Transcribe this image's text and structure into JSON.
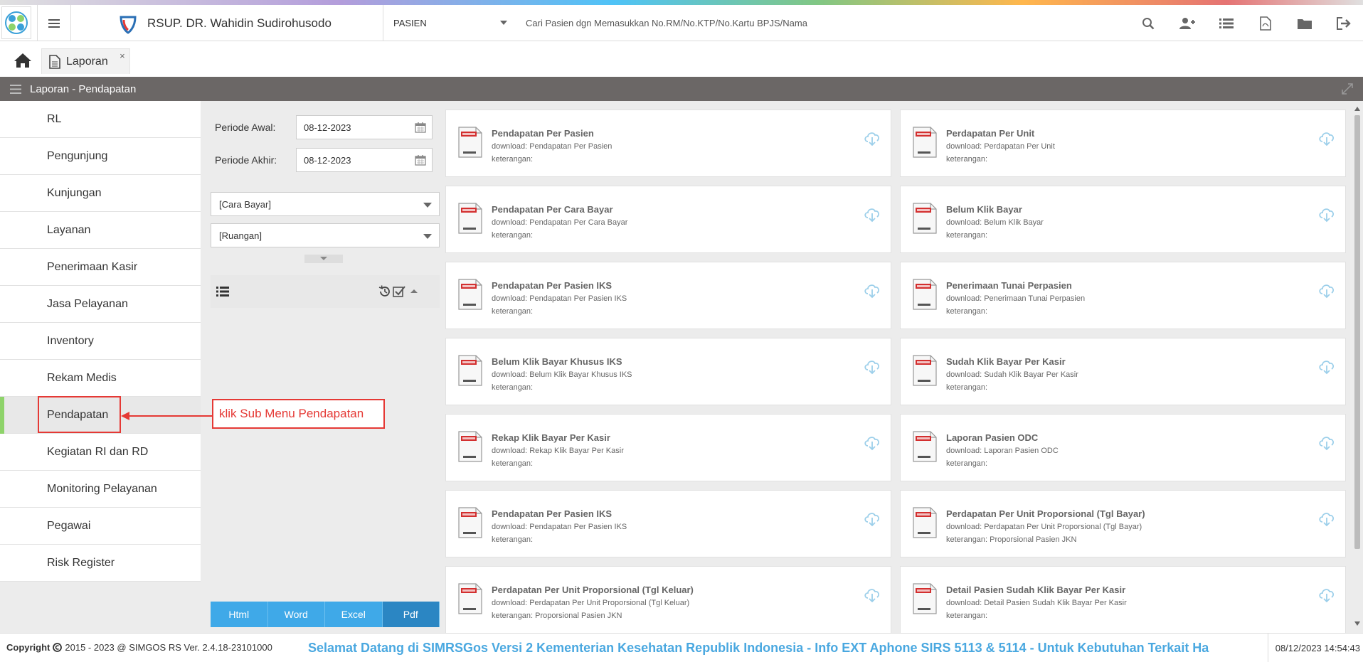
{
  "header": {
    "hospital_name": "RSUP. DR. Wahidin Sudirohusodo",
    "mode_select": "PASIEN",
    "search_placeholder": "Cari Pasien dgn Memasukkan No.RM/No.KTP/No.Kartu BPJS/Nama",
    "icons": [
      "search-icon",
      "add-user-icon",
      "list-icon",
      "pdf-file-icon",
      "folder-icon",
      "logout-icon"
    ]
  },
  "tabs": [
    {
      "label": "Laporan",
      "close": "×"
    }
  ],
  "page_title": "Laporan - Pendapatan",
  "sidebar": {
    "items": [
      {
        "label": "RL"
      },
      {
        "label": "Pengunjung"
      },
      {
        "label": "Kunjungan"
      },
      {
        "label": "Layanan"
      },
      {
        "label": "Penerimaan Kasir"
      },
      {
        "label": "Jasa Pelayanan"
      },
      {
        "label": "Inventory"
      },
      {
        "label": "Rekam Medis"
      },
      {
        "label": "Pendapatan"
      },
      {
        "label": "Kegiatan RI dan RD"
      },
      {
        "label": "Monitoring Pelayanan"
      },
      {
        "label": "Pegawai"
      },
      {
        "label": "Risk Register"
      }
    ],
    "active": "Pendapatan"
  },
  "annotation": "klik Sub Menu Pendapatan",
  "filter": {
    "periode_awal_label": "Periode Awal:",
    "periode_awal_value": "08-12-2023",
    "periode_akhir_label": "Periode Akhir:",
    "periode_akhir_value": "08-12-2023",
    "cara_bayar": "[Cara Bayar]",
    "ruangan": "[Ruangan]",
    "export_buttons": [
      "Html",
      "Word",
      "Excel",
      "Pdf"
    ],
    "selected_export": "Pdf"
  },
  "reports": [
    {
      "title": "Pendapatan Per Pasien",
      "download": "download: Pendapatan Per Pasien",
      "keterangan": "keterangan:"
    },
    {
      "title": "Perdapatan Per Unit",
      "download": "download: Perdapatan Per Unit",
      "keterangan": "keterangan:"
    },
    {
      "title": "Pendapatan Per Cara Bayar",
      "download": "download: Pendapatan Per Cara Bayar",
      "keterangan": "keterangan:"
    },
    {
      "title": "Belum Klik Bayar",
      "download": "download: Belum Klik Bayar",
      "keterangan": "keterangan:"
    },
    {
      "title": "Pendapatan Per Pasien IKS",
      "download": "download: Pendapatan Per Pasien IKS",
      "keterangan": "keterangan:"
    },
    {
      "title": "Penerimaan Tunai Perpasien",
      "download": "download: Penerimaan Tunai Perpasien",
      "keterangan": "keterangan:"
    },
    {
      "title": "Belum Klik Bayar Khusus IKS",
      "download": "download: Belum Klik Bayar Khusus IKS",
      "keterangan": "keterangan:"
    },
    {
      "title": "Sudah Klik Bayar Per Kasir",
      "download": "download: Sudah Klik Bayar Per Kasir",
      "keterangan": "keterangan:"
    },
    {
      "title": "Rekap Klik Bayar Per Kasir",
      "download": "download: Rekap Klik Bayar Per Kasir",
      "keterangan": "keterangan:"
    },
    {
      "title": "Laporan Pasien ODC",
      "download": "download: Laporan Pasien ODC",
      "keterangan": "keterangan:"
    },
    {
      "title": "Pendapatan Per Pasien IKS",
      "download": "download: Pendapatan Per Pasien IKS",
      "keterangan": "keterangan:"
    },
    {
      "title": "Perdapatan Per Unit Proporsional (Tgl Bayar)",
      "download": "download: Perdapatan Per Unit Proporsional (Tgl Bayar)",
      "keterangan": "keterangan: Proporsional Pasien JKN"
    },
    {
      "title": "Perdapatan Per Unit Proporsional (Tgl Keluar)",
      "download": "download: Perdapatan Per Unit Proporsional (Tgl Keluar)",
      "keterangan": "keterangan: Proporsional Pasien JKN"
    },
    {
      "title": "Detail Pasien Sudah Klik Bayar Per Kasir",
      "download": "download: Detail Pasien Sudah Klik Bayar Per Kasir",
      "keterangan": "keterangan:"
    }
  ],
  "footer": {
    "copyright_bold": "Copyright",
    "copyright_text": "2015 - 2023 @ SIMGOS RS Ver. 2.4.18-23101000",
    "marquee": "Selamat Datang di SIMRSGos Versi 2 Kementerian Kesehatan Republik Indonesia - Info EXT Aphone SIRS 5113 & 5114 - Untuk Kebutuhan Terkait Ha",
    "datetime": "08/12/2023 14:54:43"
  },
  "colors": {
    "page_header_bg": "#6b6766",
    "sidebar_active_marker": "#8ed36a",
    "annotation_red": "#e53935",
    "export_blue": "#3fa9e8",
    "marquee_blue": "#4aa8e0"
  }
}
